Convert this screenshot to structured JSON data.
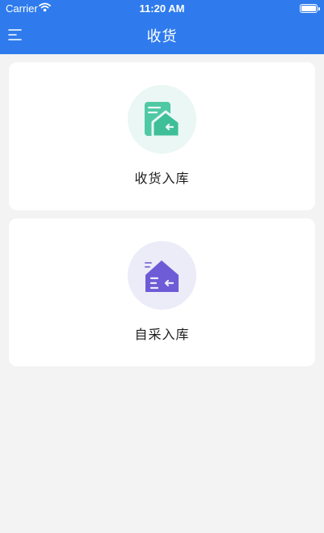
{
  "status_bar": {
    "carrier": "Carrier",
    "time": "11:20 AM"
  },
  "nav": {
    "title": "收货",
    "menu_icon": "menu-icon"
  },
  "cards": [
    {
      "label": "收货入库",
      "icon": "receive-warehouse-icon",
      "accent": "#3fc29a"
    },
    {
      "label": "自采入库",
      "icon": "purchase-warehouse-icon",
      "accent": "#6e5bd6"
    }
  ],
  "colors": {
    "primary": "#2f7bed",
    "background": "#f3f3f4"
  }
}
